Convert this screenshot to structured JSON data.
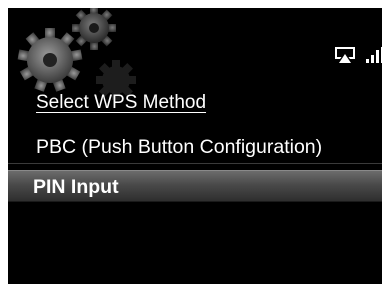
{
  "header": {
    "title": "Select WPS Method"
  },
  "menu": {
    "items": [
      {
        "label": "PBC (Push Button Configuration)",
        "selected": false
      },
      {
        "label": "PIN Input",
        "selected": true
      }
    ]
  },
  "status_icons": [
    "airplay-icon",
    "signal-strength-icon"
  ],
  "decoration": [
    "gears-icon"
  ],
  "colors": {
    "background": "#000000",
    "text": "#ffffff",
    "highlight": "#555555"
  }
}
